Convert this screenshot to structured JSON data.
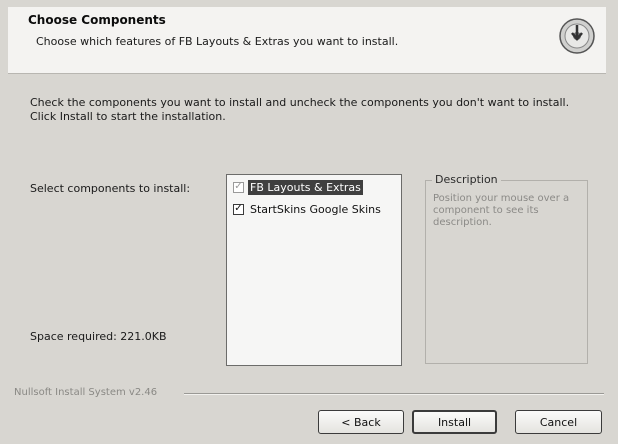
{
  "header": {
    "title": "Choose Components",
    "subtitle": "Choose which features of FB Layouts & Extras you want to install.",
    "icon": "installer-disc-icon"
  },
  "instructions": "Check the components you want to install and uncheck the components you don't want to install. Click Install to start the installation.",
  "select_label": "Select components to install:",
  "components": [
    {
      "label": "FB Layouts & Extras",
      "checked": true,
      "disabled": true,
      "selected": true
    },
    {
      "label": "StartSkins Google Skins",
      "checked": true,
      "disabled": false,
      "selected": false
    }
  ],
  "description": {
    "legend": "Description",
    "text": "Position your mouse over a component to see its description."
  },
  "space_required": "Space required: 221.0KB",
  "branding": "Nullsoft Install System v2.46",
  "buttons": {
    "back": "< Back",
    "install": "Install",
    "cancel": "Cancel"
  }
}
